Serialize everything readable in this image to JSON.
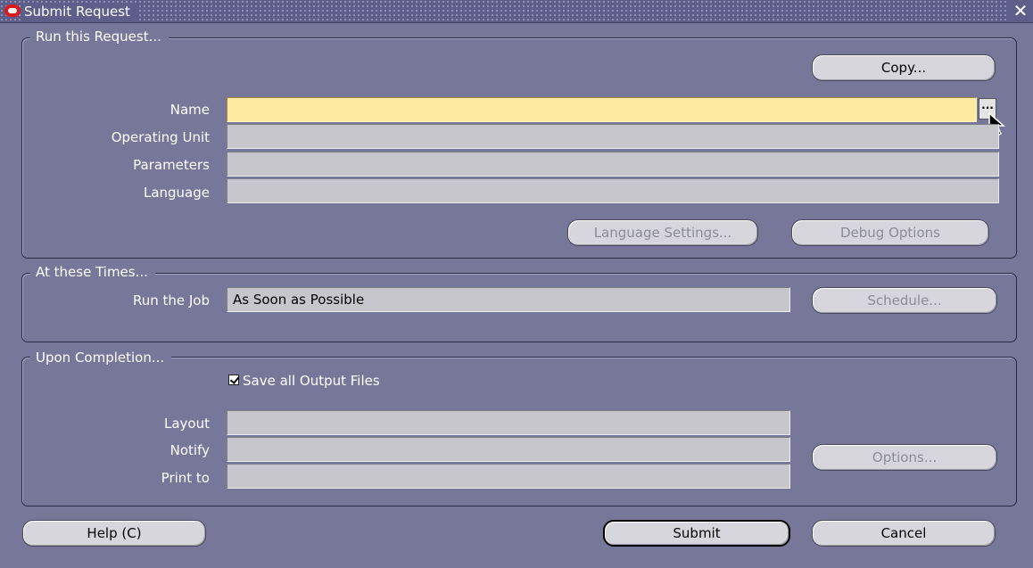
{
  "window": {
    "title": "Submit Request",
    "close_glyph": "✕",
    "logo_icon": "oracle-logo-icon"
  },
  "run_request": {
    "legend": "Run this Request...",
    "copy_label": "Copy...",
    "name_label": "Name",
    "name_value": "",
    "lov_label": "...",
    "operating_unit_label": "Operating Unit",
    "operating_unit_value": "",
    "parameters_label": "Parameters",
    "parameters_value": "",
    "language_label": "Language",
    "language_value": "",
    "language_settings_label": "Language Settings...",
    "debug_options_label": "Debug Options"
  },
  "times": {
    "legend": "At these Times...",
    "run_job_label": "Run the Job",
    "run_job_value": "As Soon as Possible",
    "schedule_label": "Schedule..."
  },
  "completion": {
    "legend": "Upon Completion...",
    "save_output_label": "Save all Output Files",
    "save_output_checked": true,
    "layout_label": "Layout",
    "layout_value": "",
    "notify_label": "Notify",
    "notify_value": "",
    "print_to_label": "Print to",
    "print_to_value": "",
    "options_label": "Options..."
  },
  "footer": {
    "help_label": "Help (C)",
    "submit_label": "Submit",
    "cancel_label": "Cancel"
  },
  "colors": {
    "background": "#77779a",
    "field": "#c6c6cc",
    "active_field": "#fde9a0",
    "button": "#d6d6dc"
  }
}
